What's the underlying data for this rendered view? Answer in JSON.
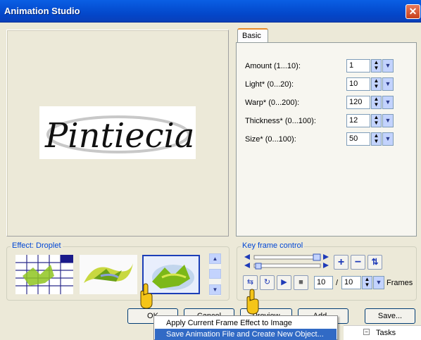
{
  "window": {
    "title": "Animation Studio",
    "close_glyph": "✕"
  },
  "preview": {
    "image_text": "Pintiecia"
  },
  "tabs": [
    {
      "label": "Basic"
    }
  ],
  "params": [
    {
      "label": "Amount (1...10):",
      "value": "1"
    },
    {
      "label": "Light* (0...20):",
      "value": "10"
    },
    {
      "label": "Warp* (0...200):",
      "value": "120"
    },
    {
      "label": "Thickness* (0...100):",
      "value": "12"
    },
    {
      "label": "Size* (0...100):",
      "value": "50"
    }
  ],
  "effect": {
    "group_label": "Effect: Droplet"
  },
  "keyframe": {
    "group_label": "Key frame control",
    "current_frame": "10",
    "separator": "/",
    "total_frames": "10",
    "frames_label": "Frames"
  },
  "buttons": {
    "ok": "OK",
    "cancel": "Cancel",
    "preview": "Preview",
    "add": "Add...",
    "save": "Save..."
  },
  "context_menu": {
    "items": [
      {
        "label": "Apply Current Frame Effect to Image",
        "highlighted": false
      },
      {
        "label": "Save Animation File and Create New Object...",
        "highlighted": true
      }
    ]
  },
  "taskpane": {
    "label": "Tasks"
  },
  "colors": {
    "titlebar": "#0550d4",
    "accent": "#0046d5",
    "highlight": "#316ac5",
    "dialog_bg": "#ece9d8"
  }
}
